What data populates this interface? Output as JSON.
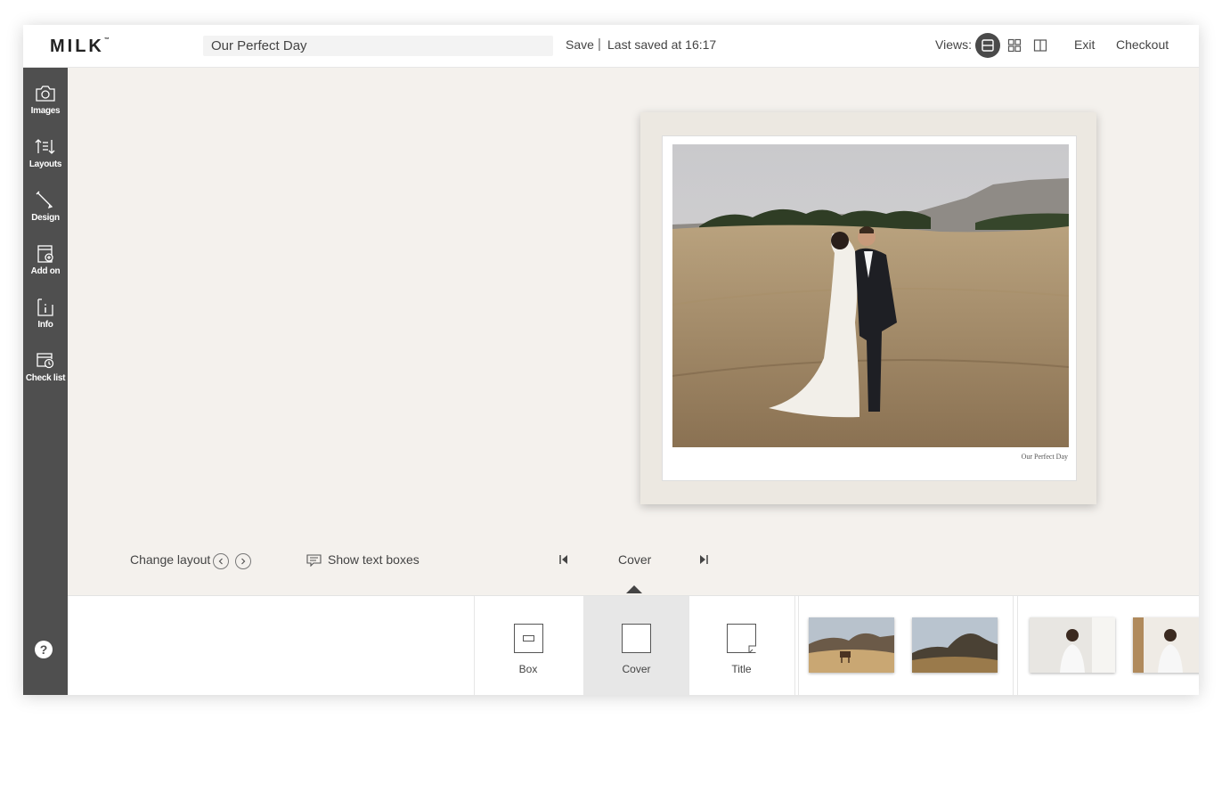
{
  "header": {
    "logo": "MILK",
    "logo_tm": "™",
    "project_title": "Our Perfect Day",
    "save_label": "Save",
    "separator": "|",
    "saved_status": "Last saved at 16:17",
    "views_label": "Views:",
    "exit_label": "Exit",
    "checkout_label": "Checkout"
  },
  "sidebar": {
    "items": [
      {
        "label": "Images",
        "icon": "camera-icon"
      },
      {
        "label": "Layouts",
        "icon": "layouts-icon"
      },
      {
        "label": "Design",
        "icon": "pencil-icon"
      },
      {
        "label": "Add on",
        "icon": "add-on-icon"
      },
      {
        "label": "Info",
        "icon": "info-icon"
      },
      {
        "label": "Check list",
        "icon": "checklist-icon"
      }
    ],
    "help_label": "?"
  },
  "canvas": {
    "cover_caption": "Our Perfect Day",
    "change_layout_label": "Change layout",
    "show_text_boxes_label": "Show text boxes",
    "page_label": "Cover"
  },
  "strip": {
    "tiles": [
      {
        "label": "Box"
      },
      {
        "label": "Cover"
      },
      {
        "label": "Title"
      }
    ]
  },
  "colors": {
    "sidebar": "#4f4f4f",
    "canvas": "#f4f1ed",
    "selected_tile": "#e7e7e7"
  }
}
